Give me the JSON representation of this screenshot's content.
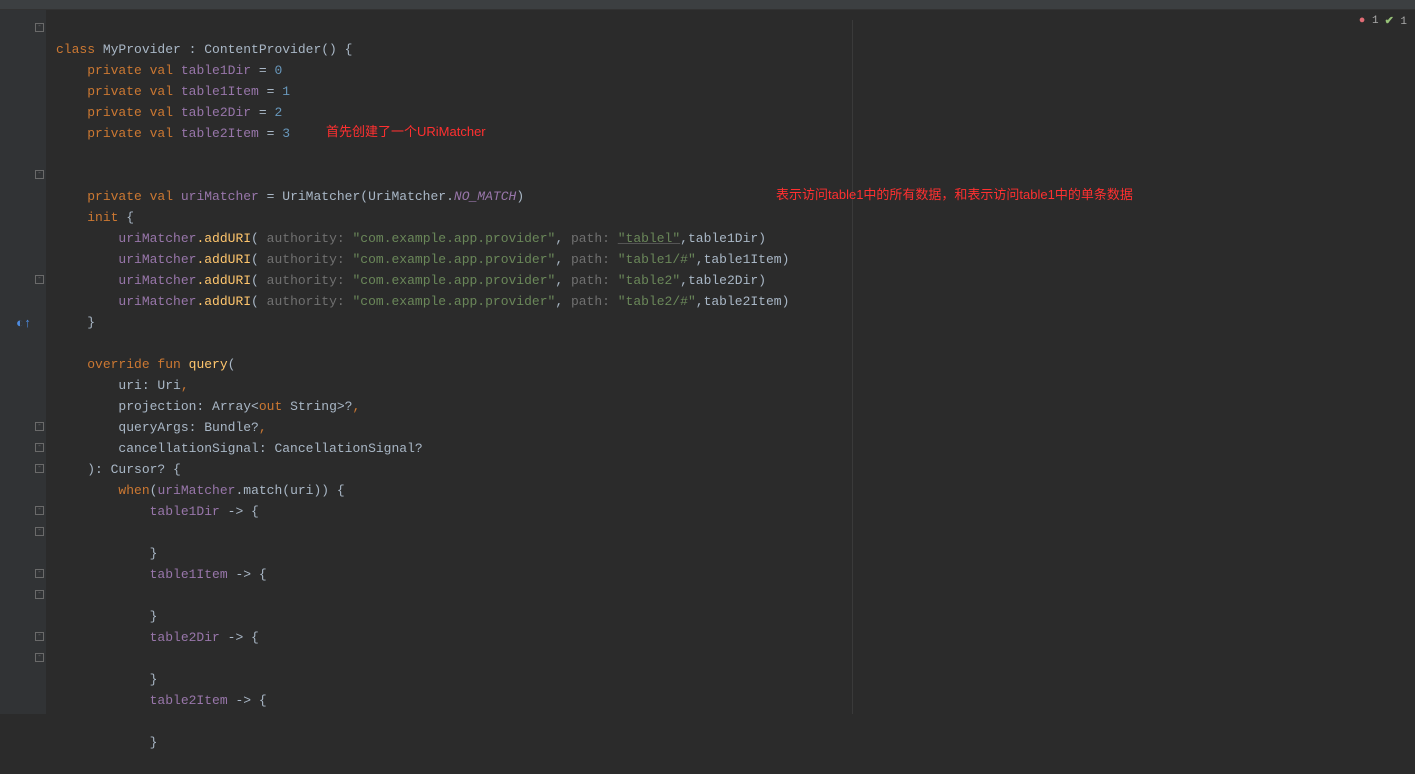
{
  "status": {
    "errors": "1",
    "warnings": "1"
  },
  "annotations": {
    "a1": "首先创建了一个URiMatcher",
    "a2": "表示访问table1中的所有数据，和表示访问table1中的单条数据"
  },
  "code": {
    "class_kw": "class ",
    "class_name": "MyProvider",
    "extends": " : ContentProvider() {",
    "priv_val": "private val ",
    "t1d": "table1Dir",
    "t1i": "table1Item",
    "t2d": "table2Dir",
    "t2i": "table2Item",
    "eq": " = ",
    "n0": "0",
    "n1": "1",
    "n2": "2",
    "n3": "3",
    "matcher_name": "uriMatcher",
    "matcher_expr1": " = UriMatcher(UriMatcher.",
    "no_match": "NO_MATCH",
    "matcher_expr2": ")",
    "init_kw": "init ",
    "brace_o": "{",
    "brace_c": "}",
    "matcher_ref": "uriMatcher",
    "addURI": ".addURI",
    "lp": "(",
    "rp": ")",
    "auth_hint": " authority: ",
    "auth_str": "\"com.example.app.provider\"",
    "comma": ",",
    "path_hint": " path: ",
    "p_table1": "\"tablel\"",
    "p_table1h": "\"table1/#\"",
    "p_table2": "\"table2\"",
    "p_table2h": "\"table2/#\"",
    "a_t1d": ",table1Dir",
    "a_t1i": ",table1Item",
    "a_t2d": ",table2Dir",
    "a_t2i": ",table2Item",
    "override_kw": "override fun ",
    "query_fn": "query",
    "q_open": "(",
    "q_uri": "uri: Uri",
    "q_c": ",",
    "q_proj1": "projection: Array<",
    "out_kw": "out ",
    "q_proj2": "String>?",
    "q_args": "queryArgs: Bundle?",
    "q_cancel": "cancellationSignal: CancellationSignal?",
    "q_close": "): Cursor? {",
    "when_kw": "when",
    "when_open": "(",
    "match_call": ".match(uri)) {",
    "arrow": " -> {"
  }
}
